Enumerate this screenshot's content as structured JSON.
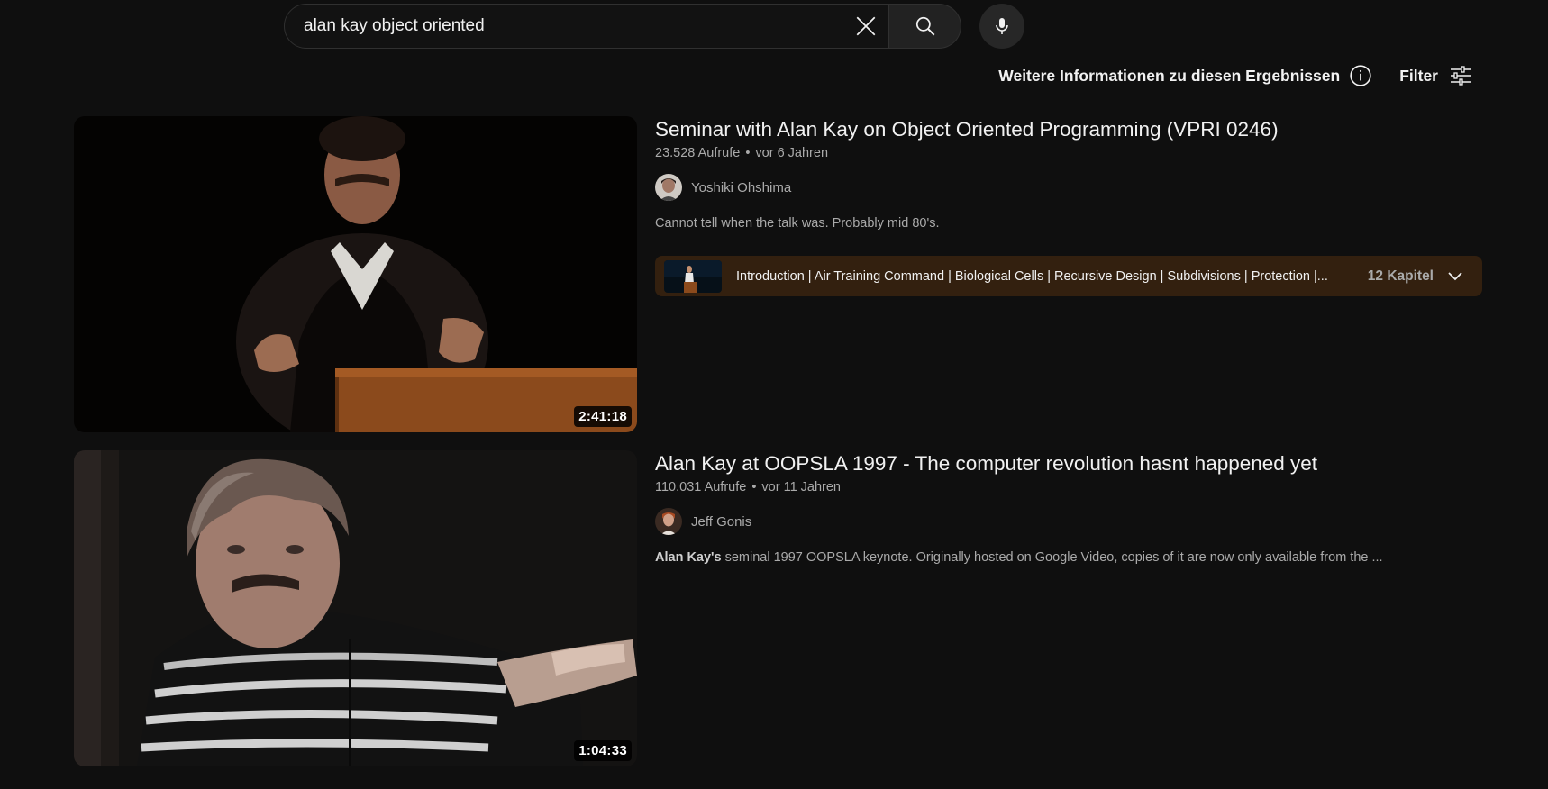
{
  "search": {
    "query": "alan kay object oriented",
    "clear_icon": "close-icon",
    "search_icon": "search-icon",
    "mic_icon": "microphone-icon"
  },
  "info_bar": {
    "info_label": "Weitere Informationen zu diesen Ergebnissen",
    "filter_label": "Filter"
  },
  "results": [
    {
      "title": "Seminar with Alan Kay on Object Oriented Programming (VPRI 0246)",
      "views": "23.528 Aufrufe",
      "age": "vor 6 Jahren",
      "channel": "Yoshiki Ohshima",
      "description_bold": "",
      "description": "Cannot tell when the talk was. Probably mid 80's.",
      "duration": "2:41:18",
      "chapters_text": "Introduction | Air Training Command | Biological Cells | Recursive Design | Subdivisions | Protection |...",
      "chapters_count": "12 Kapitel"
    },
    {
      "title": "Alan Kay at OOPSLA 1997 - The computer revolution hasnt happened yet",
      "views": "110.031 Aufrufe",
      "age": "vor 11 Jahren",
      "channel": "Jeff Gonis",
      "description_bold": "Alan Kay's",
      "description": " seminal 1997 OOPSLA keynote. Originally hosted on Google Video, copies of it are now only available from the ...",
      "duration": "1:04:33"
    }
  ],
  "colors": {
    "background": "#0f0f0f",
    "chapters_bg": "#33200f",
    "secondary_text": "#aaaaaa"
  }
}
